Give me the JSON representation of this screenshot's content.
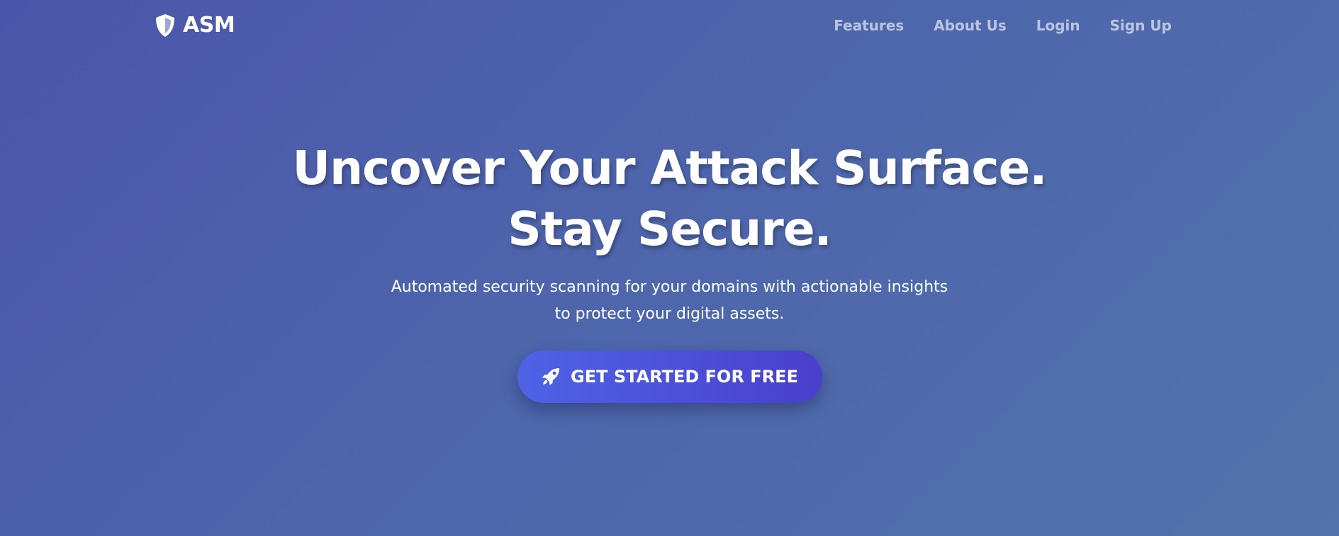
{
  "navbar": {
    "brand": {
      "icon": "shield-icon",
      "name": "ASM"
    },
    "links": [
      {
        "label": "Features"
      },
      {
        "label": "About Us"
      },
      {
        "label": "Login"
      },
      {
        "label": "Sign Up"
      }
    ]
  },
  "hero": {
    "title_line1": "Uncover Your Attack Surface.",
    "title_line2": "Stay Secure.",
    "subtitle_line1": "Automated security scanning for your domains with actionable insights",
    "subtitle_line2": "to protect your digital assets.",
    "cta": {
      "icon": "rocket-icon",
      "label": "GET STARTED FOR FREE"
    }
  },
  "colors": {
    "background_start": "#4a56ab",
    "background_end": "#5273ab",
    "cta_start": "#4e63e6",
    "cta_end": "#4a3fcc",
    "text": "#ffffff"
  }
}
